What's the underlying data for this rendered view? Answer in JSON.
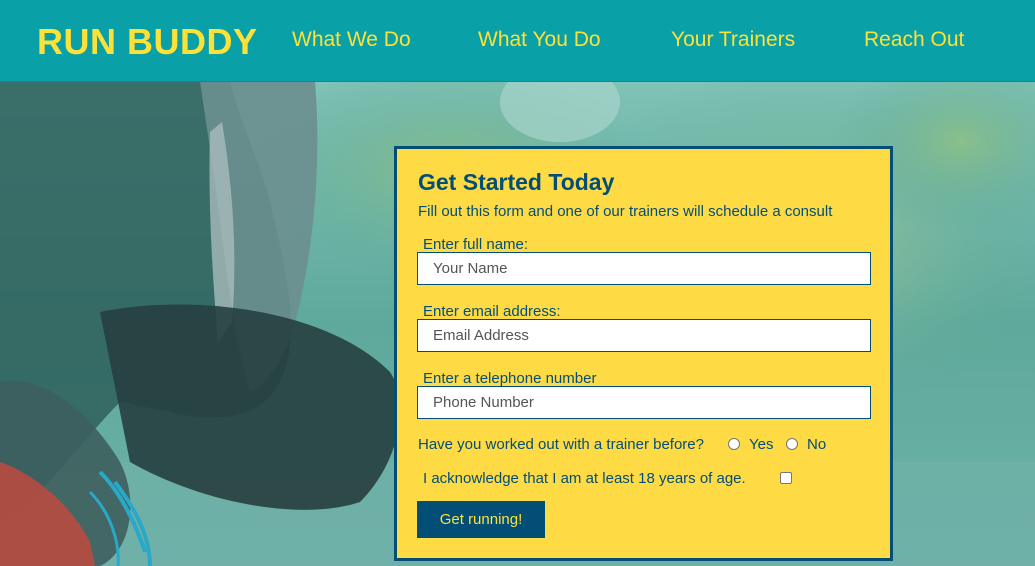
{
  "header": {
    "logo": "RUN BUDDY",
    "nav": [
      {
        "label": "What We Do"
      },
      {
        "label": "What You Do"
      },
      {
        "label": "Your Trainers"
      },
      {
        "label": "Reach Out"
      }
    ]
  },
  "form": {
    "title": "Get Started Today",
    "subtitle": "Fill out this form and one of our trainers will schedule a consult",
    "name_label": "Enter full name:",
    "name_placeholder": "Your Name",
    "email_label": "Enter email address:",
    "email_placeholder": "Email Address",
    "phone_label": "Enter a telephone number",
    "phone_placeholder": "Phone Number",
    "trainer_question": "Have you worked out with a trainer before?",
    "option_yes": "Yes",
    "option_no": "No",
    "age_ack": "I acknowledge that I am at least 18 years of age.",
    "submit_label": "Get running!"
  },
  "colors": {
    "header_bg": "#0aa0a8",
    "accent_yellow": "#fce138",
    "form_bg": "#fedb44",
    "navy": "#024e76"
  }
}
